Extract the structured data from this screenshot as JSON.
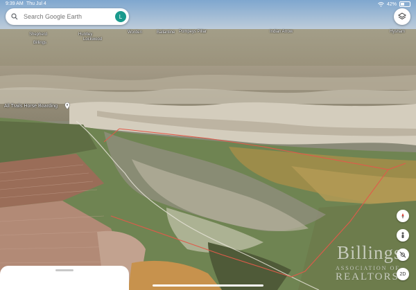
{
  "status_bar": {
    "time": "9:39 AM",
    "date": "Thu Jul 4",
    "battery": "42%"
  },
  "search": {
    "placeholder": "Search Google Earth",
    "account_initial": "L"
  },
  "places": [
    {
      "name": "Shepherd"
    },
    {
      "name": "Huntley"
    },
    {
      "name": "Worden"
    },
    {
      "name": "Pompeys Pillar"
    },
    {
      "name": "Indian Arrow"
    },
    {
      "name": "Billings"
    },
    {
      "name": "Lockwood"
    },
    {
      "name": "Ballantine"
    },
    {
      "name": "Hysham"
    }
  ],
  "pinned_place": {
    "name": "All Trails Horse Boarding"
  },
  "icons": [
    "search-icon",
    "layers-icon",
    "compass-icon",
    "street-view-icon",
    "toggle-3d-icon",
    "view-2d-icon",
    "location-pin-icon"
  ],
  "map_controls": {
    "view_mode": "2D"
  },
  "watermark": {
    "brand": "Billings",
    "line1": "ASSOCIATION OF",
    "line2": "REALTORS"
  },
  "colors": {
    "avatar": "#1a9a8d",
    "property_boundary": "#e05a4a",
    "place_label": "#ffffff"
  }
}
